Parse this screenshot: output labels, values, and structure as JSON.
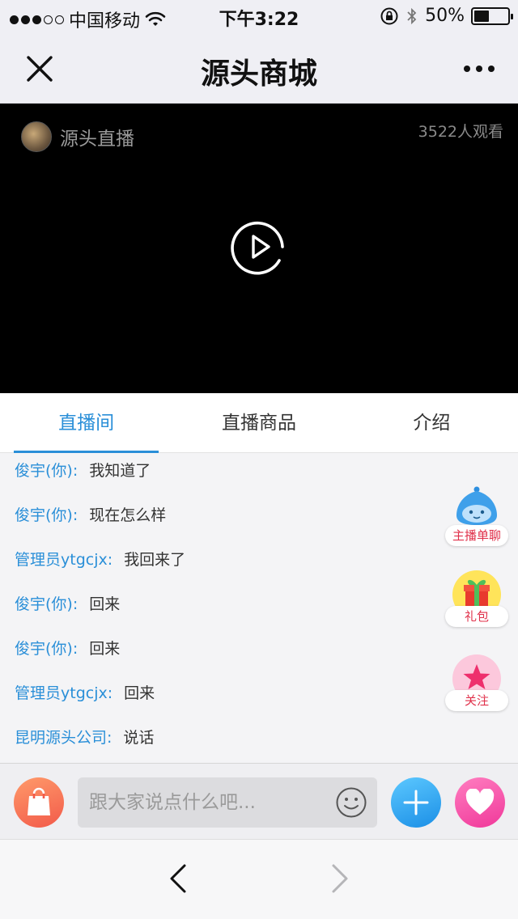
{
  "status_bar": {
    "carrier": "中国移动",
    "time": "下午3:22",
    "battery": "50%",
    "battery_level": 0.5,
    "signal_bars": 3,
    "icons": [
      "wifi-icon",
      "orientation-lock-icon",
      "bluetooth-icon",
      "battery-icon"
    ]
  },
  "nav": {
    "title": "源头商城",
    "close_icon": "close-icon",
    "more_icon": "more-icon"
  },
  "video": {
    "broadcaster": "源头直播",
    "viewers": "3522人观看",
    "play_icon": "play-icon"
  },
  "tabs": [
    {
      "label": "直播间",
      "active": true
    },
    {
      "label": "直播商品",
      "active": false
    },
    {
      "label": "介绍",
      "active": false
    }
  ],
  "chat": {
    "messages": [
      {
        "user": "俊宇(你):",
        "text": "我知道了"
      },
      {
        "user": "俊宇(你):",
        "text": "现在怎么样"
      },
      {
        "user": "管理员ytgcjx:",
        "text": "我回来了"
      },
      {
        "user": "俊宇(你):",
        "text": "回来"
      },
      {
        "user": "俊宇(你):",
        "text": "回来"
      },
      {
        "user": "管理员ytgcjx:",
        "text": "回来"
      },
      {
        "user": "昆明源头公司:",
        "text": "说话"
      }
    ]
  },
  "side_buttons": [
    {
      "label": "主播单聊",
      "icon": "anchor-chat-icon"
    },
    {
      "label": "礼包",
      "icon": "gift-icon"
    },
    {
      "label": "关注",
      "icon": "star-icon"
    }
  ],
  "input_bar": {
    "placeholder": "跟大家说点什么吧...",
    "icons": [
      "shopping-bag-icon",
      "emoji-icon",
      "plus-icon",
      "heart-icon"
    ],
    "colors": {
      "shop": "#f46a52",
      "plus": "#1b8fe6",
      "like": "#f0389a"
    }
  },
  "toolbar": {
    "icons": [
      "back-icon",
      "forward-icon"
    ]
  },
  "colors": {
    "accent": "#2a8fd8",
    "follow_red": "#e0304a"
  }
}
